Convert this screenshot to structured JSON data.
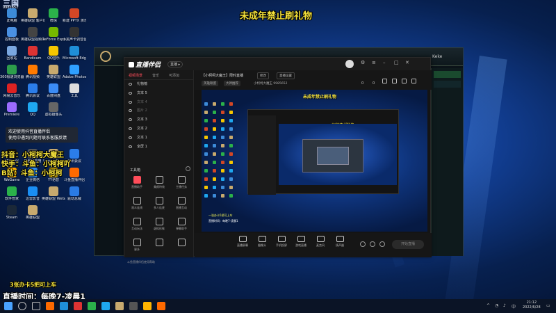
{
  "overlay": {
    "top_banner": "未成年禁止刷礼物",
    "hint_lines": [
      "欢迎使用抖音直播伴侣",
      "使用中遇到问题可联系客服反馈"
    ],
    "socials": [
      "抖音：小柯柯大魔王",
      "快手：斗鱼：小柯柯吖",
      "B站：斗鱼：小柯柯"
    ],
    "card_line": "3张办卡5把可上车",
    "live_time": "直播时间：每晚7-凌晨1"
  },
  "top_logo": {
    "big": "三国",
    "sub": "9985652"
  },
  "desktop_icons": [
    {
      "label": "此电脑",
      "color": "#3d8bd8"
    },
    {
      "label": "英雄联盟 客户端",
      "color": "#c8aa6e"
    },
    {
      "label": "微信",
      "color": "#2bb14a"
    },
    {
      "label": "新建 PPTX 演示文稿",
      "color": "#d24726"
    },
    {
      "label": "控制面板",
      "color": "#4a90e2"
    },
    {
      "label": "英雄联盟视频 bgm",
      "color": "#444"
    },
    {
      "label": "GeForce Experience",
      "color": "#76b900"
    },
    {
      "label": "小黑声卡调音台",
      "color": "#333"
    },
    {
      "label": "回收站",
      "color": "#7aa7e0"
    },
    {
      "label": "Bandicam",
      "color": "#d33"
    },
    {
      "label": "QQ音乐",
      "color": "#f6c600"
    },
    {
      "label": "Microsoft Edge",
      "color": "#1f8fd8"
    },
    {
      "label": "360极速浏览器",
      "color": "#2d9d4b"
    },
    {
      "label": "腾讯视频",
      "color": "#ff7a00"
    },
    {
      "label": "英雄联盟",
      "color": "#c8aa6e"
    },
    {
      "label": "Adobe Photosh...",
      "color": "#2fa0ff"
    },
    {
      "label": "网易云音乐",
      "color": "#d22"
    },
    {
      "label": "腾讯会议",
      "color": "#2b7de9"
    },
    {
      "label": "百度网盘",
      "color": "#3c8cf5"
    },
    {
      "label": "工具",
      "color": "#ddd"
    },
    {
      "label": "Premiere",
      "color": "#9a6cff"
    },
    {
      "label": "QQ",
      "color": "#1ea7f0"
    },
    {
      "label": "虚拟摄像头",
      "color": "#666"
    },
    {
      "label": "WPS Office",
      "color": "#d9352b"
    },
    {
      "label": "直播伴侣",
      "color": "#111"
    },
    {
      "label": "已删除应用",
      "color": "#555"
    },
    {
      "label": "LeagueDir...",
      "color": "#c8aa6e"
    },
    {
      "label": "腾讯会议",
      "color": "#2b7de9"
    },
    {
      "label": "WeGame",
      "color": "#ffb400"
    },
    {
      "label": "企业微信",
      "color": "#2d8cf0"
    },
    {
      "label": "YY语音",
      "color": "#f6c600"
    },
    {
      "label": "斗鱼直播伴侣",
      "color": "#ff6a00"
    },
    {
      "label": "软件管家",
      "color": "#2bb14a"
    },
    {
      "label": "迅雷影音",
      "color": "#1a8ef3"
    },
    {
      "label": "英雄联盟 WeGame版",
      "color": "#c8aa6e"
    },
    {
      "label": "驱动总裁",
      "color": "#2a7be4"
    },
    {
      "label": "Steam",
      "color": "#1b2838"
    },
    {
      "label": "英雄联盟",
      "color": "#c8aa6e"
    }
  ],
  "lol": {
    "profile": "Keke"
  },
  "app": {
    "name": "直播伴侣",
    "pill": "直播 ▸",
    "side_tabs": [
      "视频场景",
      "音乐",
      "可添加"
    ],
    "scenes": [
      {
        "label": "礼物榜",
        "dim": false
      },
      {
        "label": "文本 5",
        "dim": false
      },
      {
        "label": "文本 4",
        "dim": true
      },
      {
        "label": "图片 2",
        "dim": true
      },
      {
        "label": "文本 3",
        "dim": false
      },
      {
        "label": "文本 2",
        "dim": false
      },
      {
        "label": "文本 1",
        "dim": false
      },
      {
        "label": "全屏 1",
        "dim": false
      }
    ],
    "tools_title": "工具箱",
    "tools": [
      {
        "label": "直播助手",
        "red": true
      },
      {
        "label": "美颜特效",
        "red": false
      },
      {
        "label": "主播任务",
        "red": false
      },
      {
        "label": "观众连线",
        "red": false
      },
      {
        "label": "多人连麦",
        "red": false
      },
      {
        "label": "直播互动",
        "red": false
      },
      {
        "label": "互动玩法",
        "red": false
      },
      {
        "label": "虚拟形象",
        "red": false
      },
      {
        "label": "弹幕助手",
        "red": false
      },
      {
        "label": "更多",
        "red": false
      },
      {
        "label": "",
        "red": false
      },
      {
        "label": "",
        "red": false
      }
    ],
    "side_footer": "斗鱼直播伴侣使用帮助",
    "title": "【小柯柯大魔王】限时直播",
    "title_btns": [
      "修改",
      "直播设置"
    ],
    "tags": [
      "英雄联盟",
      "大神推荐"
    ],
    "room_id": "小柯柯大魔王  9985652",
    "stats": [
      "0",
      "0"
    ],
    "preview_text": "未成年禁止刷礼物",
    "preview_note": "一张办卡5把可上车",
    "preview_note2": "直播时间：每晚7-凌晨1",
    "inner_text": "未成年禁止刷礼物",
    "bottom_tools": [
      "直播屏幕",
      "摄像头",
      "手机投屏",
      "游戏直播",
      "麦克风",
      "扬声器"
    ],
    "start_label": "开始直播"
  },
  "taskbar": {
    "time": "21:12",
    "date": "2022/6/28"
  }
}
